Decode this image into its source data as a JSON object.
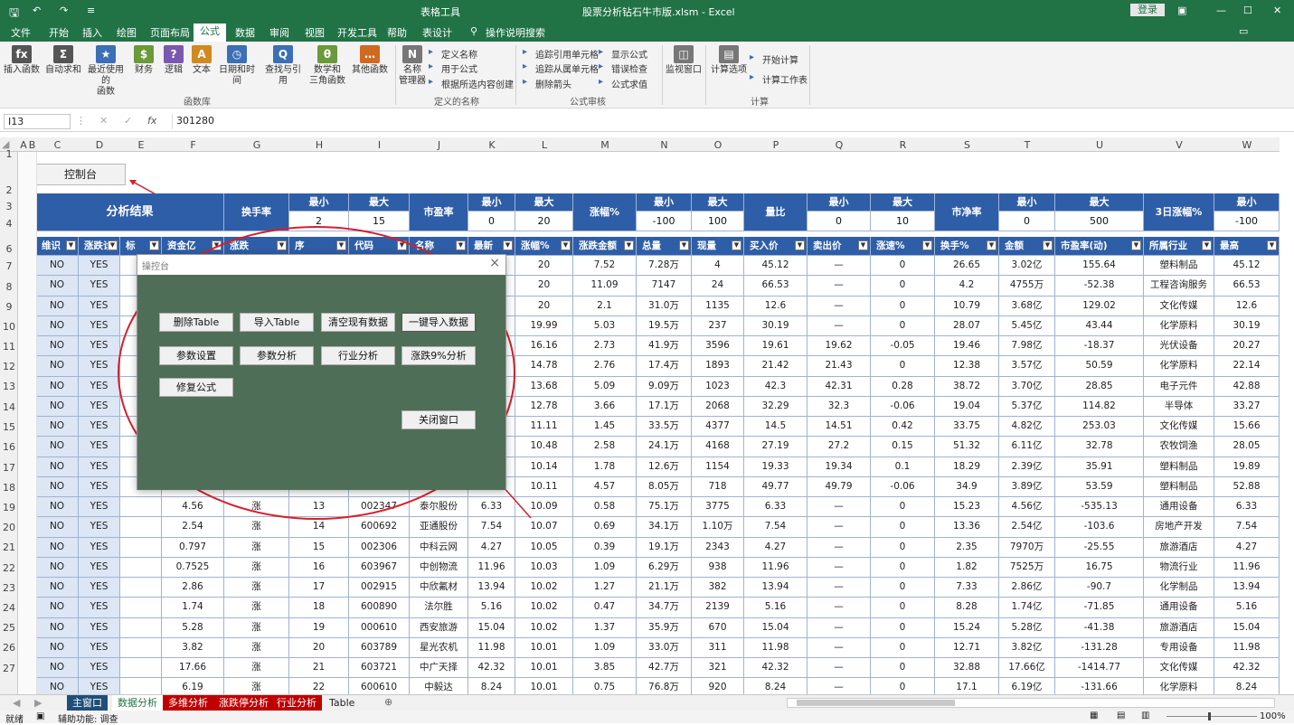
{
  "window": {
    "title": "股票分析钻石牛市版.xlsm - Excel",
    "context_tab": "表格工具",
    "login": "登录",
    "tell_me": "操作说明搜索"
  },
  "menu": [
    "文件",
    "开始",
    "插入",
    "绘图",
    "页面布局",
    "公式",
    "数据",
    "审阅",
    "视图",
    "开发工具",
    "帮助",
    "表设计"
  ],
  "active_menu": "公式",
  "ribbon": {
    "big": [
      {
        "label": "插入函数",
        "icon": "fx",
        "color": "#555555"
      },
      {
        "label": "自动求和",
        "icon": "Σ",
        "color": "#555555"
      },
      {
        "label": "最近使用的\n函数",
        "icon": "★",
        "color": "#3b6fb6"
      },
      {
        "label": "财务",
        "icon": "$",
        "color": "#6a9a3a"
      },
      {
        "label": "逻辑",
        "icon": "?",
        "color": "#7a58b0"
      },
      {
        "label": "文本",
        "icon": "A",
        "color": "#d08a20"
      },
      {
        "label": "日期和时间",
        "icon": "◷",
        "color": "#3b6fb6"
      },
      {
        "label": "查找与引用",
        "icon": "Q",
        "color": "#3b6fb6"
      },
      {
        "label": "数学和\n三角函数",
        "icon": "θ",
        "color": "#6a9a3a"
      },
      {
        "label": "其他函数",
        "icon": "…",
        "color": "#d06a20"
      },
      {
        "label": "名称\n管理器",
        "icon": "N",
        "color": "#777777"
      },
      {
        "label": "监视窗口",
        "icon": "◫",
        "color": "#777777"
      },
      {
        "label": "计算选项",
        "icon": "▤",
        "color": "#777777"
      }
    ],
    "small": {
      "name_define": "定义名称",
      "name_use": "用于公式",
      "name_create": "根据所选内容创建",
      "trace_prec": "追踪引用单元格",
      "trace_dep": "追踪从属单元格",
      "remove_arrows": "删除箭头",
      "show_formula": "显示公式",
      "error_check": "错误检查",
      "eval_formula": "公式求值",
      "calc_now": "开始计算",
      "calc_sheet": "计算工作表"
    },
    "groups": {
      "lib": "函数库",
      "names": "定义的名称",
      "audit": "公式审核",
      "calc": "计算"
    }
  },
  "formula_bar": {
    "name_box": "I13",
    "fx": "fx",
    "value": "301280"
  },
  "columns": [
    "A",
    "B",
    "C",
    "D",
    "E",
    "F",
    "G",
    "H",
    "I",
    "J",
    "K",
    "L",
    "M",
    "N",
    "O",
    "P",
    "Q",
    "R",
    "S",
    "T",
    "U",
    "V",
    "W"
  ],
  "row_numbers": [
    "1",
    "2",
    "3",
    "4",
    "6",
    "7",
    "8",
    "9",
    "10",
    "11",
    "12",
    "13",
    "14",
    "15",
    "16",
    "17",
    "18",
    "19",
    "20",
    "21",
    "22",
    "23",
    "24",
    "25",
    "26",
    "27"
  ],
  "control_label": "控制台",
  "header_block": {
    "title": "分析结果",
    "min": "最小",
    "max": "最大",
    "groups": [
      {
        "label": "换手率",
        "min": "2",
        "max": "15"
      },
      {
        "label": "市盈率",
        "min": "0",
        "max": "20"
      },
      {
        "label": "涨幅%",
        "min": "-100",
        "max": "100"
      },
      {
        "label": "量比",
        "min": "0",
        "max": "10"
      },
      {
        "label": "市净率",
        "min": "0",
        "max": "500"
      },
      {
        "label": "3日涨幅%",
        "min": "-100",
        "max": ""
      }
    ]
  },
  "table_headers": [
    "维识",
    "涨跌诊",
    "标",
    "资金亿",
    "涨跌",
    "序",
    "代码",
    "名称",
    "最新",
    "涨幅%",
    "涨跌金额",
    "总量",
    "现量",
    "买入价",
    "卖出价",
    "涨速%",
    "换手%",
    "金额",
    "市盈率(动)",
    "所属行业",
    "最高"
  ],
  "rows": [
    [
      "NO",
      "YES",
      "",
      "",
      "",
      "",
      "",
      "",
      "",
      "20",
      "7.52",
      "7.28万",
      "4",
      "45.12",
      "—",
      "0",
      "26.65",
      "3.02亿",
      "155.64",
      "塑料制品",
      "45.12"
    ],
    [
      "NO",
      "YES",
      "",
      "",
      "",
      "",
      "",
      "",
      "",
      "20",
      "11.09",
      "7147",
      "24",
      "66.53",
      "—",
      "0",
      "4.2",
      "4755万",
      "-52.38",
      "工程咨询服务",
      "66.53"
    ],
    [
      "NO",
      "YES",
      "",
      "",
      "",
      "",
      "",
      "",
      "",
      "20",
      "2.1",
      "31.0万",
      "1135",
      "12.6",
      "—",
      "0",
      "10.79",
      "3.68亿",
      "129.02",
      "文化传媒",
      "12.6"
    ],
    [
      "NO",
      "YES",
      "",
      "",
      "",
      "",
      "",
      "",
      "",
      "19.99",
      "5.03",
      "19.5万",
      "237",
      "30.19",
      "—",
      "0",
      "28.07",
      "5.45亿",
      "43.44",
      "化学原料",
      "30.19"
    ],
    [
      "NO",
      "YES",
      "",
      "",
      "",
      "",
      "",
      "",
      "",
      "16.16",
      "2.73",
      "41.9万",
      "3596",
      "19.61",
      "19.62",
      "-0.05",
      "19.46",
      "7.98亿",
      "-18.37",
      "光伏设备",
      "20.27"
    ],
    [
      "NO",
      "YES",
      "",
      "",
      "",
      "",
      "",
      "",
      "",
      "14.78",
      "2.76",
      "17.4万",
      "1893",
      "21.42",
      "21.43",
      "0",
      "12.38",
      "3.57亿",
      "50.59",
      "化学原料",
      "22.14"
    ],
    [
      "NO",
      "YES",
      "",
      "",
      "",
      "",
      "",
      "",
      "",
      "13.68",
      "5.09",
      "9.09万",
      "1023",
      "42.3",
      "42.31",
      "0.28",
      "38.72",
      "3.70亿",
      "28.85",
      "电子元件",
      "42.88"
    ],
    [
      "NO",
      "YES",
      "",
      "",
      "",
      "",
      "",
      "",
      "",
      "12.78",
      "3.66",
      "17.1万",
      "2068",
      "32.29",
      "32.3",
      "-0.06",
      "19.04",
      "5.37亿",
      "114.82",
      "半导体",
      "33.27"
    ],
    [
      "NO",
      "YES",
      "",
      "",
      "",
      "",
      "",
      "",
      "",
      "11.11",
      "1.45",
      "33.5万",
      "4377",
      "14.5",
      "14.51",
      "0.42",
      "33.75",
      "4.82亿",
      "253.03",
      "文化传媒",
      "15.66"
    ],
    [
      "NO",
      "YES",
      "",
      "",
      "",
      "",
      "",
      "",
      "",
      "10.48",
      "2.58",
      "24.1万",
      "4168",
      "27.19",
      "27.2",
      "0.15",
      "51.32",
      "6.11亿",
      "32.78",
      "农牧饲渔",
      "28.05"
    ],
    [
      "NO",
      "YES",
      "",
      "",
      "",
      "",
      "",
      "",
      "",
      "10.14",
      "1.78",
      "12.6万",
      "1154",
      "19.33",
      "19.34",
      "0.1",
      "18.29",
      "2.39亿",
      "35.91",
      "塑料制品",
      "19.89"
    ],
    [
      "NO",
      "YES",
      "",
      "",
      "",
      "",
      "",
      "",
      "",
      "10.11",
      "4.57",
      "8.05万",
      "718",
      "49.77",
      "49.79",
      "-0.06",
      "34.9",
      "3.89亿",
      "53.59",
      "塑料制品",
      "52.88"
    ],
    [
      "NO",
      "YES",
      "",
      "4.56",
      "涨",
      "13",
      "002347",
      "泰尔股份",
      "6.33",
      "10.09",
      "0.58",
      "75.1万",
      "3775",
      "6.33",
      "—",
      "0",
      "15.23",
      "4.56亿",
      "-535.13",
      "通用设备",
      "6.33"
    ],
    [
      "NO",
      "YES",
      "",
      "2.54",
      "涨",
      "14",
      "600692",
      "亚通股份",
      "7.54",
      "10.07",
      "0.69",
      "34.1万",
      "1.10万",
      "7.54",
      "—",
      "0",
      "13.36",
      "2.54亿",
      "-103.6",
      "房地产开发",
      "7.54"
    ],
    [
      "NO",
      "YES",
      "",
      "0.797",
      "涨",
      "15",
      "002306",
      "中科云网",
      "4.27",
      "10.05",
      "0.39",
      "19.1万",
      "2343",
      "4.27",
      "—",
      "0",
      "2.35",
      "7970万",
      "-25.55",
      "旅游酒店",
      "4.27"
    ],
    [
      "NO",
      "YES",
      "",
      "0.7525",
      "涨",
      "16",
      "603967",
      "中创物流",
      "11.96",
      "10.03",
      "1.09",
      "6.29万",
      "938",
      "11.96",
      "—",
      "0",
      "1.82",
      "7525万",
      "16.75",
      "物流行业",
      "11.96"
    ],
    [
      "NO",
      "YES",
      "",
      "2.86",
      "涨",
      "17",
      "002915",
      "中欣氟材",
      "13.94",
      "10.02",
      "1.27",
      "21.1万",
      "382",
      "13.94",
      "—",
      "0",
      "7.33",
      "2.86亿",
      "-90.7",
      "化学制品",
      "13.94"
    ],
    [
      "NO",
      "YES",
      "",
      "1.74",
      "涨",
      "18",
      "600890",
      "法尔胜",
      "5.16",
      "10.02",
      "0.47",
      "34.7万",
      "2139",
      "5.16",
      "—",
      "0",
      "8.28",
      "1.74亿",
      "-71.85",
      "通用设备",
      "5.16"
    ],
    [
      "NO",
      "YES",
      "",
      "5.28",
      "涨",
      "19",
      "000610",
      "西安旅游",
      "15.04",
      "10.02",
      "1.37",
      "35.9万",
      "670",
      "15.04",
      "—",
      "0",
      "15.24",
      "5.28亿",
      "-41.38",
      "旅游酒店",
      "15.04"
    ],
    [
      "NO",
      "YES",
      "",
      "3.82",
      "涨",
      "20",
      "603789",
      "星光农机",
      "11.98",
      "10.01",
      "1.09",
      "33.0万",
      "311",
      "11.98",
      "—",
      "0",
      "12.71",
      "3.82亿",
      "-131.28",
      "专用设备",
      "11.98"
    ],
    [
      "NO",
      "YES",
      "",
      "17.66",
      "涨",
      "21",
      "603721",
      "中广天择",
      "42.32",
      "10.01",
      "3.85",
      "42.7万",
      "321",
      "42.32",
      "—",
      "0",
      "32.88",
      "17.66亿",
      "-1414.77",
      "文化传媒",
      "42.32"
    ],
    [
      "NO",
      "YES",
      "",
      "6.19",
      "涨",
      "22",
      "600610",
      "中毅达",
      "8.24",
      "10.01",
      "0.75",
      "76.8万",
      "920",
      "8.24",
      "—",
      "0",
      "17.1",
      "6.19亿",
      "-131.66",
      "化学原料",
      "8.24"
    ]
  ],
  "dialog": {
    "title": "操控台",
    "close": "×",
    "buttons": [
      "删除Table",
      "导入Table",
      "清空现有数据",
      "一键导入数据",
      "参数设置",
      "参数分析",
      "行业分析",
      "涨跌9%分析",
      "修复公式",
      "关闭窗口"
    ]
  },
  "sheet_tabs": [
    {
      "label": "主窗口",
      "bg": "#1f4e79",
      "fg": "#ffffff"
    },
    {
      "label": "数据分析",
      "bg": "#ffffff",
      "fg": "#217346"
    },
    {
      "label": "多维分析",
      "bg": "#c00000",
      "fg": "#ffffff"
    },
    {
      "label": "涨跌停分析",
      "bg": "#c00000",
      "fg": "#ffffff"
    },
    {
      "label": "行业分析",
      "bg": "#c00000",
      "fg": "#ffffff"
    },
    {
      "label": "Table",
      "bg": "#f0f0f0",
      "fg": "#222222"
    }
  ],
  "status": {
    "ready": "就绪",
    "access": "辅助功能: 调查",
    "zoom": "100%"
  }
}
